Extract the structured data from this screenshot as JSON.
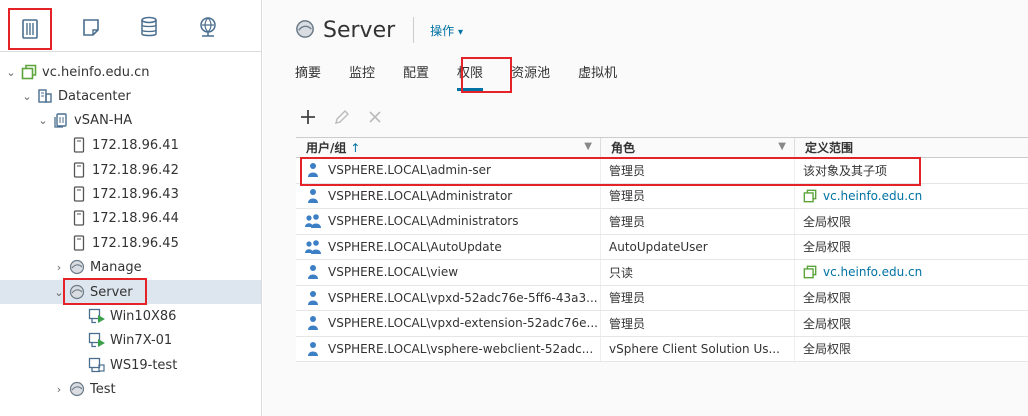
{
  "colors": {
    "accent": "#0072a3",
    "highlight": "#e52228",
    "vc_green": "#5ba53b",
    "user_blue": "#3d7fc4"
  },
  "nav_tabs": [
    {
      "name": "hosts-clusters",
      "icon": "hosts-clusters-icon"
    },
    {
      "name": "vms-templates",
      "icon": "vms-templates-icon"
    },
    {
      "name": "storage",
      "icon": "storage-icon"
    },
    {
      "name": "networking",
      "icon": "networking-icon"
    }
  ],
  "tree": {
    "vcenter": "vc.heinfo.edu.cn",
    "datacenter": "Datacenter",
    "cluster": "vSAN-HA",
    "hosts": [
      "172.18.96.41",
      "172.18.96.42",
      "172.18.96.43",
      "172.18.96.44",
      "172.18.96.45"
    ],
    "pool_manage": "Manage",
    "pool_server": "Server",
    "vms": [
      "Win10X86",
      "Win7X-01",
      "WS19-test"
    ],
    "pool_test": "Test"
  },
  "header": {
    "title": "Server",
    "actions_label": "操作"
  },
  "tabs": [
    "摘要",
    "监控",
    "配置",
    "权限",
    "资源池",
    "虚拟机"
  ],
  "active_tab": "权限",
  "grid": {
    "columns": [
      "用户/组",
      "角色",
      "定义范围"
    ],
    "sort_arrow": "↑",
    "rows": [
      {
        "user": "VSPHERE.LOCAL\\admin-ser",
        "role": "管理员",
        "scope": "该对象及其子项",
        "user_icon": "user-icon",
        "scope_is_link": false
      },
      {
        "user": "VSPHERE.LOCAL\\Administrator",
        "role": "管理员",
        "scope": "vc.heinfo.edu.cn",
        "user_icon": "user-icon",
        "scope_is_link": true
      },
      {
        "user": "VSPHERE.LOCAL\\Administrators",
        "role": "管理员",
        "scope": "全局权限",
        "user_icon": "group-icon",
        "scope_is_link": false
      },
      {
        "user": "VSPHERE.LOCAL\\AutoUpdate",
        "role": "AutoUpdateUser",
        "scope": "全局权限",
        "user_icon": "group-icon",
        "scope_is_link": false
      },
      {
        "user": "VSPHERE.LOCAL\\view",
        "role": "只读",
        "scope": "vc.heinfo.edu.cn",
        "user_icon": "user-icon",
        "scope_is_link": true
      },
      {
        "user": "VSPHERE.LOCAL\\vpxd-52adc76e-5ff6-43a3...",
        "role": "管理员",
        "scope": "全局权限",
        "user_icon": "user-icon",
        "scope_is_link": false
      },
      {
        "user": "VSPHERE.LOCAL\\vpxd-extension-52adc76e...",
        "role": "管理员",
        "scope": "全局权限",
        "user_icon": "user-icon",
        "scope_is_link": false
      },
      {
        "user": "VSPHERE.LOCAL\\vsphere-webclient-52adc...",
        "role": "vSphere Client Solution Us...",
        "scope": "全局权限",
        "user_icon": "user-icon",
        "scope_is_link": false
      }
    ]
  }
}
